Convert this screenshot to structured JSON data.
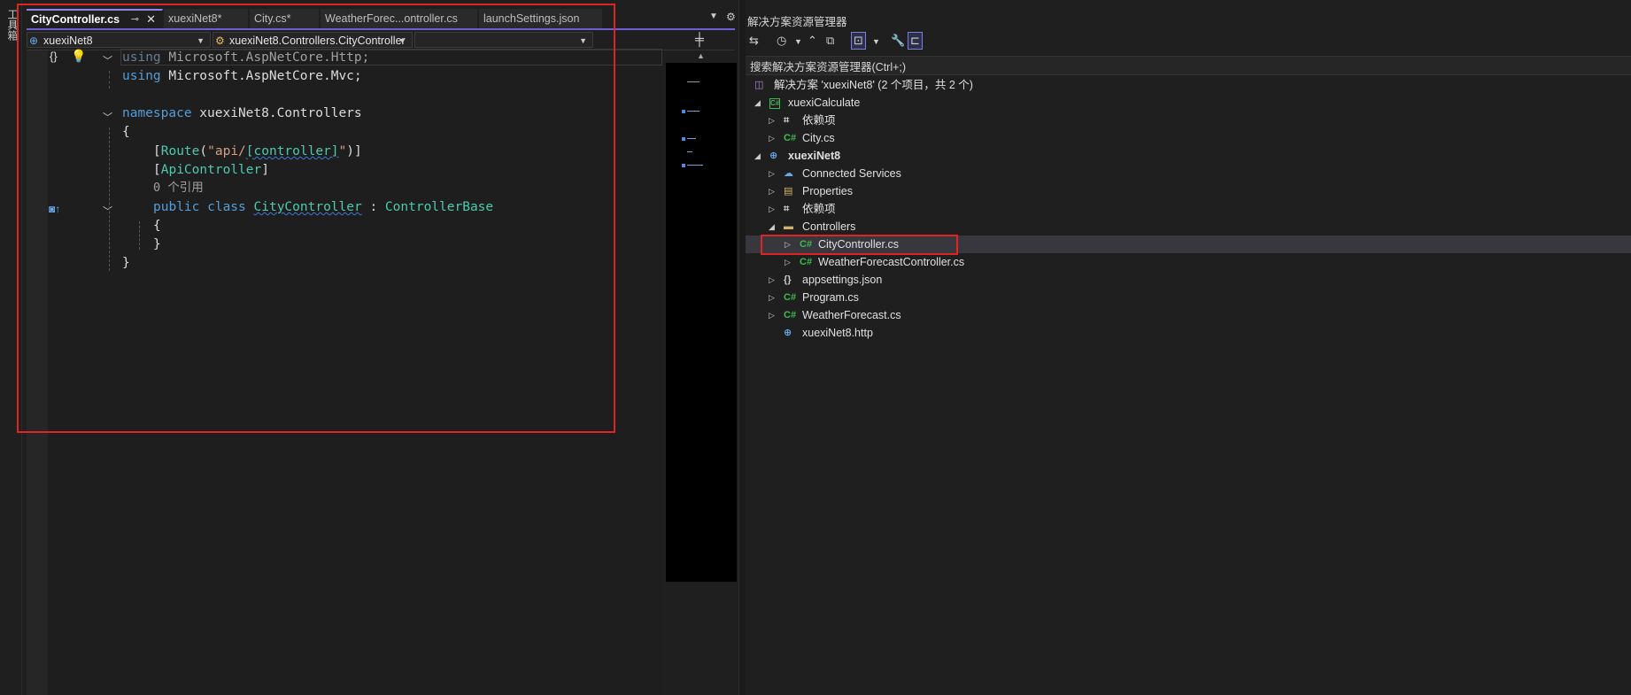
{
  "toolbox": {
    "label": "工具箱"
  },
  "tabs": [
    {
      "label": "CityController.cs",
      "active": true
    },
    {
      "label": "xuexiNet8*"
    },
    {
      "label": "City.cs*"
    },
    {
      "label": "WeatherForec...ontroller.cs"
    },
    {
      "label": "launchSettings.json"
    }
  ],
  "navbar": {
    "project": "xuexiNet8",
    "type": "xuexiNet8.Controllers.CityController",
    "member": ""
  },
  "code": {
    "l1_kw": "using",
    "l1_rest": " Microsoft.AspNetCore.Http;",
    "l2_kw": "using",
    "l2_rest": " Microsoft.AspNetCore.Mvc;",
    "l3_kw": "namespace",
    "l3_rest": " xuexiNet8.Controllers",
    "l4": "{",
    "l5_open": "[",
    "l5_route": "Route",
    "l5_paren": "(",
    "l5_str1": "\"api/",
    "l5_ctrl": "[controller]",
    "l5_str2": "\"",
    "l5_close": ")]",
    "l6_open": "[",
    "l6_attr": "ApiController",
    "l6_close": "]",
    "l7": "0 个引用",
    "l8_kw": "public class",
    "l8_name": "CityController",
    "l8_sep": " : ",
    "l8_base": "ControllerBase",
    "l9": "{",
    "l10": "}",
    "l11": "}"
  },
  "solution_explorer": {
    "title": "解决方案资源管理器",
    "search_placeholder": "搜索解决方案资源管理器(Ctrl+;)",
    "items": [
      {
        "label": "解决方案 'xuexiNet8' (2 个项目，共 2 个)",
        "icon": "solution-icon"
      },
      {
        "label": "xuexiCalculate",
        "icon": "csproj-icon"
      },
      {
        "label": "依赖项",
        "icon": "dependencies-icon"
      },
      {
        "label": "City.cs",
        "icon": "csharp-icon"
      },
      {
        "label": "xuexiNet8",
        "icon": "web-project-icon",
        "bold": true
      },
      {
        "label": "Connected Services",
        "icon": "connected-services-icon"
      },
      {
        "label": "Properties",
        "icon": "properties-icon"
      },
      {
        "label": "依赖项",
        "icon": "dependencies-icon"
      },
      {
        "label": "Controllers",
        "icon": "folder-icon"
      },
      {
        "label": "CityController.cs",
        "icon": "csharp-icon",
        "selected": true
      },
      {
        "label": "WeatherForecastController.cs",
        "icon": "csharp-icon"
      },
      {
        "label": "appsettings.json",
        "icon": "json-icon"
      },
      {
        "label": "Program.cs",
        "icon": "csharp-icon"
      },
      {
        "label": "WeatherForecast.cs",
        "icon": "csharp-icon"
      },
      {
        "label": "xuexiNet8.http",
        "icon": "http-icon"
      }
    ],
    "csharp_glyph": "C#"
  },
  "colors": {
    "accent": "#6d5fd6",
    "highlight": "#e02424",
    "keyword": "#569cd6",
    "type": "#4ec9b0",
    "string": "#d69d85"
  }
}
